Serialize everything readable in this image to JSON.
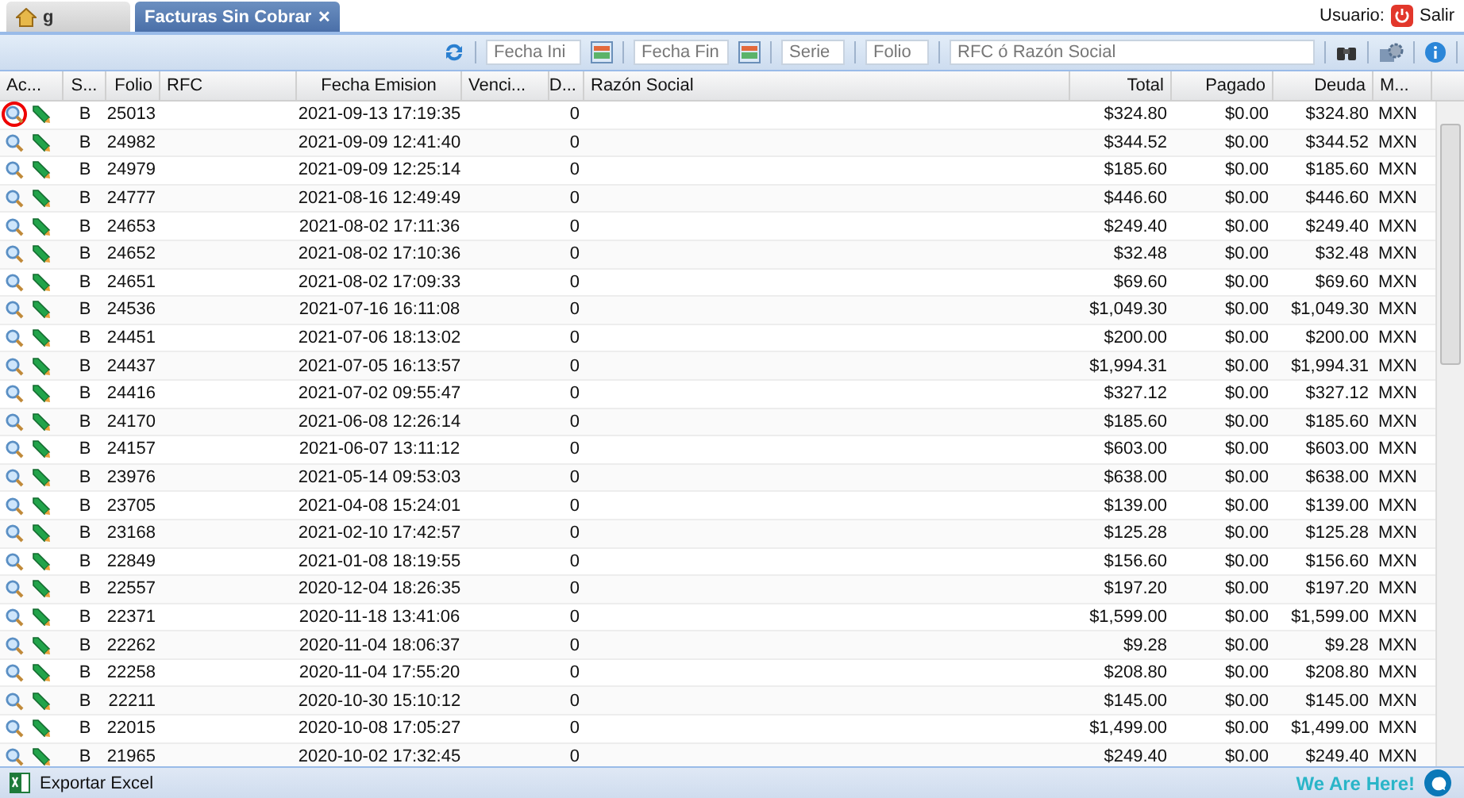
{
  "tabs": [
    {
      "kind": "home",
      "label": "g",
      "selected": false
    },
    {
      "kind": "page",
      "label": "Facturas Sin Cobrar",
      "close": "✕",
      "selected": true
    }
  ],
  "user": {
    "label": "Usuario:",
    "logout": "Salir"
  },
  "toolbar": {
    "fields": [
      {
        "placeholder": "Fecha Ini",
        "calendar": true
      },
      {
        "placeholder": "Fecha Fin",
        "calendar": true
      },
      {
        "placeholder": "Serie",
        "calendar": false
      },
      {
        "placeholder": "Folio",
        "calendar": false
      },
      {
        "placeholder": "RFC ó Razón Social",
        "calendar": false,
        "wide": true
      }
    ]
  },
  "table": {
    "columns": [
      "Ac...",
      "S...",
      "Folio",
      "RFC",
      "Fecha Emision",
      "Venci...",
      "D...",
      "Razón Social",
      "Total",
      "Pagado",
      "Deuda",
      "M..."
    ],
    "rows": [
      {
        "highlighted": true,
        "serie": "B",
        "folio": "25013",
        "fecha": "2021-09-13 17:19:35",
        "d": "0",
        "total": "$324.80",
        "pagado": "$0.00",
        "deuda": "$324.80",
        "moneda": "MXN"
      },
      {
        "highlighted": false,
        "serie": "B",
        "folio": "24982",
        "fecha": "2021-09-09 12:41:40",
        "d": "0",
        "total": "$344.52",
        "pagado": "$0.00",
        "deuda": "$344.52",
        "moneda": "MXN"
      },
      {
        "highlighted": false,
        "serie": "B",
        "folio": "24979",
        "fecha": "2021-09-09 12:25:14",
        "d": "0",
        "total": "$185.60",
        "pagado": "$0.00",
        "deuda": "$185.60",
        "moneda": "MXN"
      },
      {
        "highlighted": false,
        "serie": "B",
        "folio": "24777",
        "fecha": "2021-08-16 12:49:49",
        "d": "0",
        "total": "$446.60",
        "pagado": "$0.00",
        "deuda": "$446.60",
        "moneda": "MXN"
      },
      {
        "highlighted": false,
        "serie": "B",
        "folio": "24653",
        "fecha": "2021-08-02 17:11:36",
        "d": "0",
        "total": "$249.40",
        "pagado": "$0.00",
        "deuda": "$249.40",
        "moneda": "MXN"
      },
      {
        "highlighted": false,
        "serie": "B",
        "folio": "24652",
        "fecha": "2021-08-02 17:10:36",
        "d": "0",
        "total": "$32.48",
        "pagado": "$0.00",
        "deuda": "$32.48",
        "moneda": "MXN"
      },
      {
        "highlighted": false,
        "serie": "B",
        "folio": "24651",
        "fecha": "2021-08-02 17:09:33",
        "d": "0",
        "total": "$69.60",
        "pagado": "$0.00",
        "deuda": "$69.60",
        "moneda": "MXN"
      },
      {
        "highlighted": false,
        "serie": "B",
        "folio": "24536",
        "fecha": "2021-07-16 16:11:08",
        "d": "0",
        "total": "$1,049.30",
        "pagado": "$0.00",
        "deuda": "$1,049.30",
        "moneda": "MXN"
      },
      {
        "highlighted": false,
        "serie": "B",
        "folio": "24451",
        "fecha": "2021-07-06 18:13:02",
        "d": "0",
        "total": "$200.00",
        "pagado": "$0.00",
        "deuda": "$200.00",
        "moneda": "MXN"
      },
      {
        "highlighted": false,
        "serie": "B",
        "folio": "24437",
        "fecha": "2021-07-05 16:13:57",
        "d": "0",
        "total": "$1,994.31",
        "pagado": "$0.00",
        "deuda": "$1,994.31",
        "moneda": "MXN"
      },
      {
        "highlighted": false,
        "serie": "B",
        "folio": "24416",
        "fecha": "2021-07-02 09:55:47",
        "d": "0",
        "total": "$327.12",
        "pagado": "$0.00",
        "deuda": "$327.12",
        "moneda": "MXN"
      },
      {
        "highlighted": false,
        "serie": "B",
        "folio": "24170",
        "fecha": "2021-06-08 12:26:14",
        "d": "0",
        "total": "$185.60",
        "pagado": "$0.00",
        "deuda": "$185.60",
        "moneda": "MXN"
      },
      {
        "highlighted": false,
        "serie": "B",
        "folio": "24157",
        "fecha": "2021-06-07 13:11:12",
        "d": "0",
        "total": "$603.00",
        "pagado": "$0.00",
        "deuda": "$603.00",
        "moneda": "MXN"
      },
      {
        "highlighted": false,
        "serie": "B",
        "folio": "23976",
        "fecha": "2021-05-14 09:53:03",
        "d": "0",
        "total": "$638.00",
        "pagado": "$0.00",
        "deuda": "$638.00",
        "moneda": "MXN"
      },
      {
        "highlighted": false,
        "serie": "B",
        "folio": "23705",
        "fecha": "2021-04-08 15:24:01",
        "d": "0",
        "total": "$139.00",
        "pagado": "$0.00",
        "deuda": "$139.00",
        "moneda": "MXN"
      },
      {
        "highlighted": false,
        "serie": "B",
        "folio": "23168",
        "fecha": "2021-02-10 17:42:57",
        "d": "0",
        "total": "$125.28",
        "pagado": "$0.00",
        "deuda": "$125.28",
        "moneda": "MXN"
      },
      {
        "highlighted": false,
        "serie": "B",
        "folio": "22849",
        "fecha": "2021-01-08 18:19:55",
        "d": "0",
        "total": "$156.60",
        "pagado": "$0.00",
        "deuda": "$156.60",
        "moneda": "MXN"
      },
      {
        "highlighted": false,
        "serie": "B",
        "folio": "22557",
        "fecha": "2020-12-04 18:26:35",
        "d": "0",
        "total": "$197.20",
        "pagado": "$0.00",
        "deuda": "$197.20",
        "moneda": "MXN"
      },
      {
        "highlighted": false,
        "serie": "B",
        "folio": "22371",
        "fecha": "2020-11-18 13:41:06",
        "d": "0",
        "total": "$1,599.00",
        "pagado": "$0.00",
        "deuda": "$1,599.00",
        "moneda": "MXN"
      },
      {
        "highlighted": false,
        "serie": "B",
        "folio": "22262",
        "fecha": "2020-11-04 18:06:37",
        "d": "0",
        "total": "$9.28",
        "pagado": "$0.00",
        "deuda": "$9.28",
        "moneda": "MXN"
      },
      {
        "highlighted": false,
        "serie": "B",
        "folio": "22258",
        "fecha": "2020-11-04 17:55:20",
        "d": "0",
        "total": "$208.80",
        "pagado": "$0.00",
        "deuda": "$208.80",
        "moneda": "MXN"
      },
      {
        "highlighted": false,
        "serie": "B",
        "folio": "22211",
        "fecha": "2020-10-30 15:10:12",
        "d": "0",
        "total": "$145.00",
        "pagado": "$0.00",
        "deuda": "$145.00",
        "moneda": "MXN"
      },
      {
        "highlighted": false,
        "serie": "B",
        "folio": "22015",
        "fecha": "2020-10-08 17:05:27",
        "d": "0",
        "total": "$1,499.00",
        "pagado": "$0.00",
        "deuda": "$1,499.00",
        "moneda": "MXN"
      },
      {
        "highlighted": false,
        "serie": "B",
        "folio": "21965",
        "fecha": "2020-10-02 17:32:45",
        "d": "0",
        "total": "$249.40",
        "pagado": "$0.00",
        "deuda": "$249.40",
        "moneda": "MXN"
      }
    ]
  },
  "footer": {
    "export": "Exportar Excel"
  },
  "chat": {
    "tagline": "We Are Here!"
  }
}
